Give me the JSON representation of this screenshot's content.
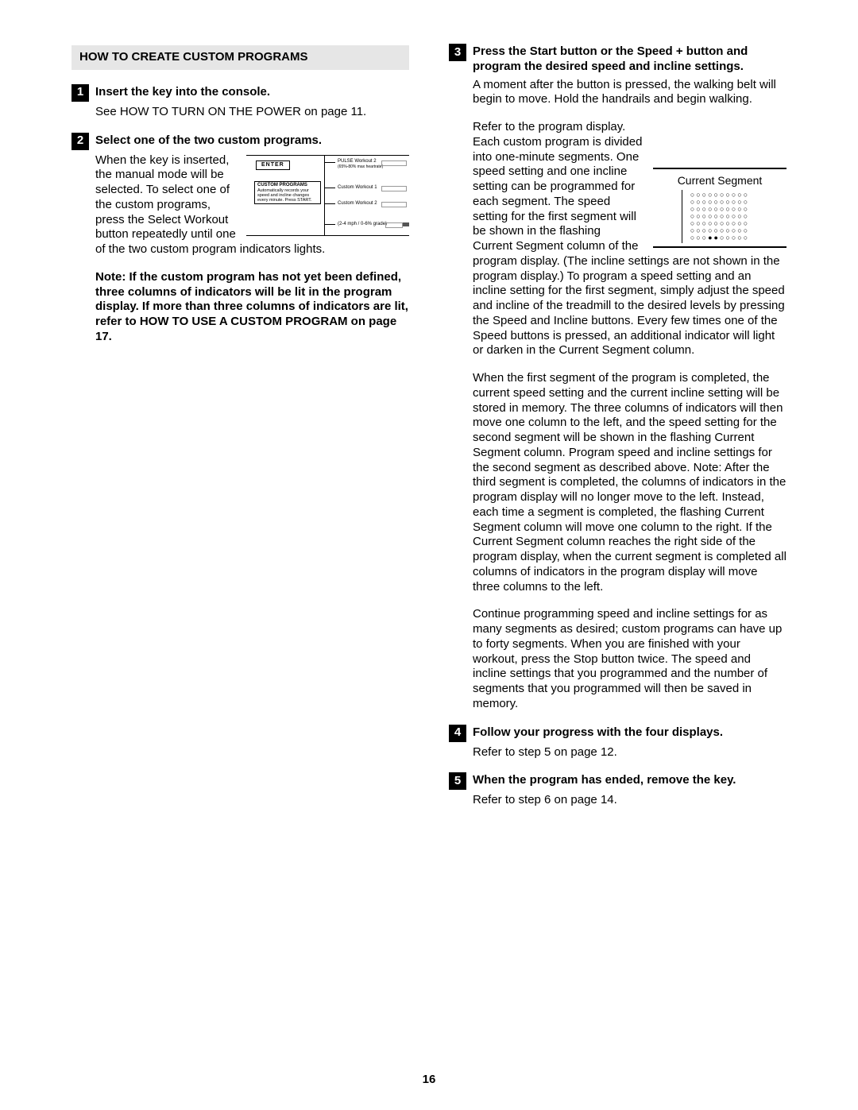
{
  "section_heading": "HOW TO CREATE CUSTOM PROGRAMS",
  "step1": {
    "num": "1",
    "title": "Insert the key into the console.",
    "p1": "See HOW TO TURN ON THE POWER on page 11."
  },
  "step2": {
    "num": "2",
    "title": "Select one of the two custom programs.",
    "p1": "When the key is inserted, the manual mode will be selected. To select one of the custom programs, press the Select Workout button repeatedly until one of the two custom program indicators lights.",
    "note": "Note: If the custom program has not yet been defined, three columns of indicators will be lit in the program display. If more than three columns of indicators are lit, refer to HOW TO USE A CUSTOM PROGRAM on page 17.",
    "diag": {
      "enter": "ENTER",
      "pulse_label": "PULSE Workout 2",
      "pulse_sub": "(65%-80% max heartrate)",
      "cp_title": "CUSTOM PROGRAMS",
      "cp_body": "Automatically records your speed and incline changes every minute. Press START.",
      "cw1": "Custom Workout 1",
      "cw2": "Custom Workout 2",
      "foot": "(2-4 mph / 0-6% grade)"
    }
  },
  "step3": {
    "num": "3",
    "title": "Press the Start button or the Speed + button and program the desired speed and incline settings.",
    "p1": "A moment after the button is pressed, the walking belt will begin to move. Hold the handrails and begin walking.",
    "p2": "Refer to the program display. Each custom program is divided into one-minute segments. One speed setting and one incline setting can be programmed for each segment. The speed setting for the first segment will be shown in the flashing Current Segment column of the program display. (The incline settings are not shown in the program display.) To program a speed setting and an incline setting for the first segment, simply adjust the speed and incline of the treadmill to the desired levels by pressing the Speed and Incline buttons. Every few times one of the Speed buttons is pressed, an additional indicator will light or darken in the Current Segment column.",
    "p3": "When the first segment of the program is completed, the current speed setting and the current incline setting will be stored in memory. The three columns of indicators will then move one column to the left, and the speed setting for the second segment will be shown in the flashing Current Segment column. Program speed and incline settings for the second segment as described above. Note: After the third segment is completed, the columns of indicators in the program display will no longer move to the left. Instead, each time a segment is completed, the flashing Current Segment column will move one column to the right. If the Current Segment column reaches the right side of the program display, when the current segment is completed all columns of indicators in the program display will move three columns to the left.",
    "p4": "Continue programming speed and incline settings for as many segments as desired; custom programs can have up to forty segments. When you are finished with your workout, press the Stop button twice. The speed and incline settings that you programmed and the number of segments that you programmed will then be saved in memory.",
    "diag_label": "Current Segment"
  },
  "step4": {
    "num": "4",
    "title": "Follow your progress with the four displays.",
    "p1": "Refer to step 5 on page 12."
  },
  "step5": {
    "num": "5",
    "title": "When the program has ended, remove the key.",
    "p1": "Refer to step 6 on page 14."
  },
  "page_number": "16"
}
